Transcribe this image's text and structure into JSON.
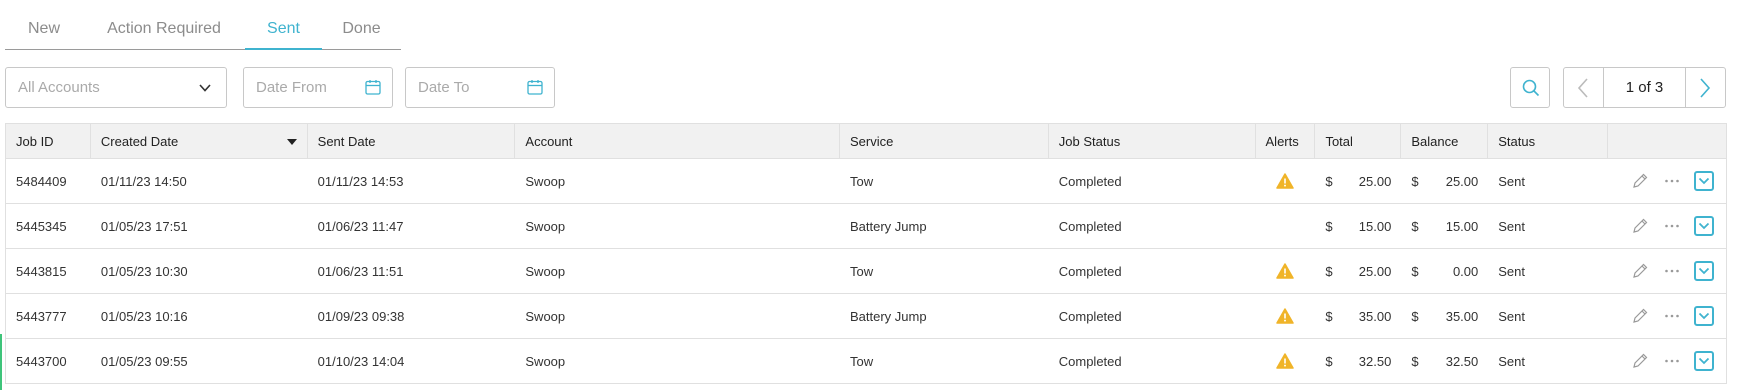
{
  "tabs": [
    {
      "label": "New",
      "active": false
    },
    {
      "label": "Action Required",
      "active": false
    },
    {
      "label": "Sent",
      "active": true
    },
    {
      "label": "Done",
      "active": false
    }
  ],
  "filters": {
    "accounts_placeholder": "All Accounts",
    "date_from_placeholder": "Date From",
    "date_to_placeholder": "Date To"
  },
  "pager": {
    "label": "1 of 3"
  },
  "colors": {
    "accent": "#3fb3cf",
    "warning": "#f0b429"
  },
  "table": {
    "columns": [
      "Job ID",
      "Created Date",
      "Sent Date",
      "Account",
      "Service",
      "Job Status",
      "Alerts",
      "Total",
      "Balance",
      "Status",
      ""
    ],
    "sorted_column": "Created Date",
    "rows": [
      {
        "job_id": "5484409",
        "created": "01/11/23 14:50",
        "sent": "01/11/23 14:53",
        "account": "Swoop",
        "service": "Tow",
        "job_status": "Completed",
        "alert": true,
        "total_cur": "$",
        "total": "25.00",
        "bal_cur": "$",
        "balance": "25.00",
        "status": "Sent"
      },
      {
        "job_id": "5445345",
        "created": "01/05/23 17:51",
        "sent": "01/06/23 11:47",
        "account": "Swoop",
        "service": "Battery Jump",
        "job_status": "Completed",
        "alert": false,
        "total_cur": "$",
        "total": "15.00",
        "bal_cur": "$",
        "balance": "15.00",
        "status": "Sent"
      },
      {
        "job_id": "5443815",
        "created": "01/05/23 10:30",
        "sent": "01/06/23 11:51",
        "account": "Swoop",
        "service": "Tow",
        "job_status": "Completed",
        "alert": true,
        "total_cur": "$",
        "total": "25.00",
        "bal_cur": "$",
        "balance": "0.00",
        "status": "Sent"
      },
      {
        "job_id": "5443777",
        "created": "01/05/23 10:16",
        "sent": "01/09/23 09:38",
        "account": "Swoop",
        "service": "Battery Jump",
        "job_status": "Completed",
        "alert": true,
        "total_cur": "$",
        "total": "35.00",
        "bal_cur": "$",
        "balance": "35.00",
        "status": "Sent"
      },
      {
        "job_id": "5443700",
        "created": "01/05/23 09:55",
        "sent": "01/10/23 14:04",
        "account": "Swoop",
        "service": "Tow",
        "job_status": "Completed",
        "alert": true,
        "total_cur": "$",
        "total": "32.50",
        "bal_cur": "$",
        "balance": "32.50",
        "status": "Sent"
      }
    ]
  },
  "icons": {
    "alert": "warning-triangle-icon",
    "edit": "pencil-icon",
    "more": "more-horizontal-icon",
    "expand": "chevron-down-icon",
    "search": "search-icon",
    "calendar": "calendar-icon"
  }
}
